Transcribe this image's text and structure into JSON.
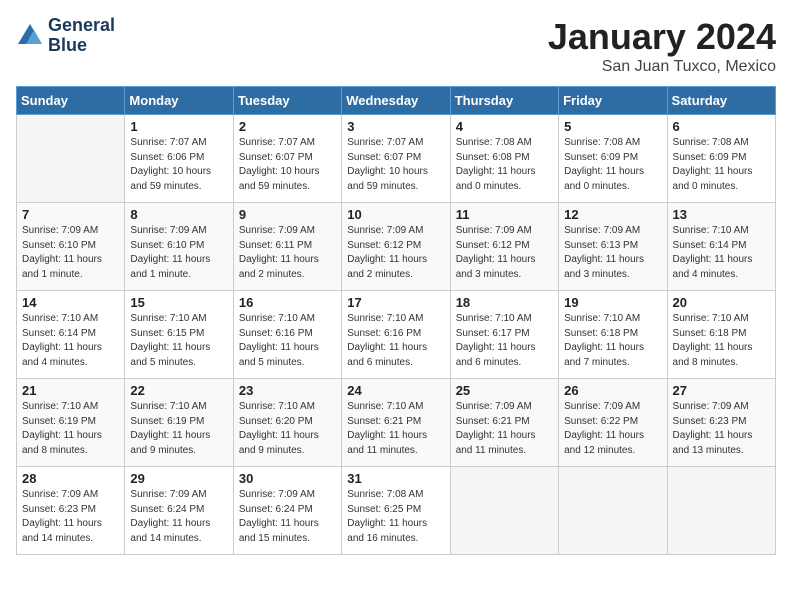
{
  "header": {
    "logo_line1": "General",
    "logo_line2": "Blue",
    "month": "January 2024",
    "location": "San Juan Tuxco, Mexico"
  },
  "weekdays": [
    "Sunday",
    "Monday",
    "Tuesday",
    "Wednesday",
    "Thursday",
    "Friday",
    "Saturday"
  ],
  "weeks": [
    [
      {
        "day": "",
        "info": ""
      },
      {
        "day": "1",
        "info": "Sunrise: 7:07 AM\nSunset: 6:06 PM\nDaylight: 10 hours\nand 59 minutes."
      },
      {
        "day": "2",
        "info": "Sunrise: 7:07 AM\nSunset: 6:07 PM\nDaylight: 10 hours\nand 59 minutes."
      },
      {
        "day": "3",
        "info": "Sunrise: 7:07 AM\nSunset: 6:07 PM\nDaylight: 10 hours\nand 59 minutes."
      },
      {
        "day": "4",
        "info": "Sunrise: 7:08 AM\nSunset: 6:08 PM\nDaylight: 11 hours\nand 0 minutes."
      },
      {
        "day": "5",
        "info": "Sunrise: 7:08 AM\nSunset: 6:09 PM\nDaylight: 11 hours\nand 0 minutes."
      },
      {
        "day": "6",
        "info": "Sunrise: 7:08 AM\nSunset: 6:09 PM\nDaylight: 11 hours\nand 0 minutes."
      }
    ],
    [
      {
        "day": "7",
        "info": "Sunrise: 7:09 AM\nSunset: 6:10 PM\nDaylight: 11 hours\nand 1 minute."
      },
      {
        "day": "8",
        "info": "Sunrise: 7:09 AM\nSunset: 6:10 PM\nDaylight: 11 hours\nand 1 minute."
      },
      {
        "day": "9",
        "info": "Sunrise: 7:09 AM\nSunset: 6:11 PM\nDaylight: 11 hours\nand 2 minutes."
      },
      {
        "day": "10",
        "info": "Sunrise: 7:09 AM\nSunset: 6:12 PM\nDaylight: 11 hours\nand 2 minutes."
      },
      {
        "day": "11",
        "info": "Sunrise: 7:09 AM\nSunset: 6:12 PM\nDaylight: 11 hours\nand 3 minutes."
      },
      {
        "day": "12",
        "info": "Sunrise: 7:09 AM\nSunset: 6:13 PM\nDaylight: 11 hours\nand 3 minutes."
      },
      {
        "day": "13",
        "info": "Sunrise: 7:10 AM\nSunset: 6:14 PM\nDaylight: 11 hours\nand 4 minutes."
      }
    ],
    [
      {
        "day": "14",
        "info": "Sunrise: 7:10 AM\nSunset: 6:14 PM\nDaylight: 11 hours\nand 4 minutes."
      },
      {
        "day": "15",
        "info": "Sunrise: 7:10 AM\nSunset: 6:15 PM\nDaylight: 11 hours\nand 5 minutes."
      },
      {
        "day": "16",
        "info": "Sunrise: 7:10 AM\nSunset: 6:16 PM\nDaylight: 11 hours\nand 5 minutes."
      },
      {
        "day": "17",
        "info": "Sunrise: 7:10 AM\nSunset: 6:16 PM\nDaylight: 11 hours\nand 6 minutes."
      },
      {
        "day": "18",
        "info": "Sunrise: 7:10 AM\nSunset: 6:17 PM\nDaylight: 11 hours\nand 6 minutes."
      },
      {
        "day": "19",
        "info": "Sunrise: 7:10 AM\nSunset: 6:18 PM\nDaylight: 11 hours\nand 7 minutes."
      },
      {
        "day": "20",
        "info": "Sunrise: 7:10 AM\nSunset: 6:18 PM\nDaylight: 11 hours\nand 8 minutes."
      }
    ],
    [
      {
        "day": "21",
        "info": "Sunrise: 7:10 AM\nSunset: 6:19 PM\nDaylight: 11 hours\nand 8 minutes."
      },
      {
        "day": "22",
        "info": "Sunrise: 7:10 AM\nSunset: 6:19 PM\nDaylight: 11 hours\nand 9 minutes."
      },
      {
        "day": "23",
        "info": "Sunrise: 7:10 AM\nSunset: 6:20 PM\nDaylight: 11 hours\nand 9 minutes."
      },
      {
        "day": "24",
        "info": "Sunrise: 7:10 AM\nSunset: 6:21 PM\nDaylight: 11 hours\nand 11 minutes."
      },
      {
        "day": "25",
        "info": "Sunrise: 7:09 AM\nSunset: 6:21 PM\nDaylight: 11 hours\nand 11 minutes."
      },
      {
        "day": "26",
        "info": "Sunrise: 7:09 AM\nSunset: 6:22 PM\nDaylight: 11 hours\nand 12 minutes."
      },
      {
        "day": "27",
        "info": "Sunrise: 7:09 AM\nSunset: 6:23 PM\nDaylight: 11 hours\nand 13 minutes."
      }
    ],
    [
      {
        "day": "28",
        "info": "Sunrise: 7:09 AM\nSunset: 6:23 PM\nDaylight: 11 hours\nand 14 minutes."
      },
      {
        "day": "29",
        "info": "Sunrise: 7:09 AM\nSunset: 6:24 PM\nDaylight: 11 hours\nand 14 minutes."
      },
      {
        "day": "30",
        "info": "Sunrise: 7:09 AM\nSunset: 6:24 PM\nDaylight: 11 hours\nand 15 minutes."
      },
      {
        "day": "31",
        "info": "Sunrise: 7:08 AM\nSunset: 6:25 PM\nDaylight: 11 hours\nand 16 minutes."
      },
      {
        "day": "",
        "info": ""
      },
      {
        "day": "",
        "info": ""
      },
      {
        "day": "",
        "info": ""
      }
    ]
  ]
}
